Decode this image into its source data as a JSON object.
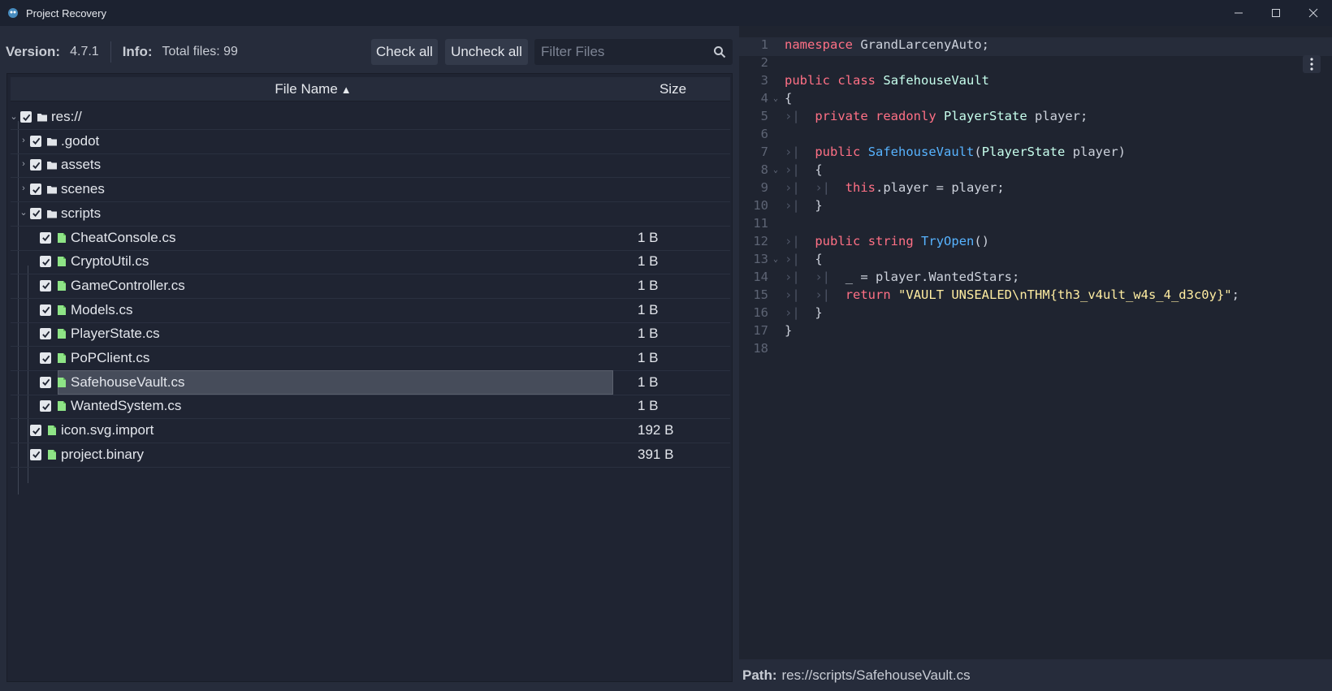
{
  "window": {
    "title": "Project Recovery",
    "controls": [
      "minimize-icon",
      "maximize-icon",
      "close-icon"
    ]
  },
  "toolbar": {
    "version_label": "Version:",
    "version_value": "4.7.1",
    "info_label": "Info:",
    "info_value": "Total files: 99",
    "check_all": "Check all",
    "uncheck_all": "Uncheck all",
    "filter_placeholder": "Filter Files"
  },
  "tree": {
    "columns": {
      "name": "File Name",
      "size": "Size"
    },
    "rows": [
      {
        "name": "res://",
        "size": "",
        "type": "folder",
        "expanded": true
      },
      {
        "name": ".godot",
        "size": "",
        "type": "folder",
        "expanded": false
      },
      {
        "name": "assets",
        "size": "",
        "type": "folder",
        "expanded": false
      },
      {
        "name": "scenes",
        "size": "",
        "type": "folder",
        "expanded": false
      },
      {
        "name": "scripts",
        "size": "",
        "type": "folder",
        "expanded": true
      },
      {
        "name": "CheatConsole.cs",
        "size": "1 B",
        "type": "file"
      },
      {
        "name": "CryptoUtil.cs",
        "size": "1 B",
        "type": "file"
      },
      {
        "name": "GameController.cs",
        "size": "1 B",
        "type": "file"
      },
      {
        "name": "Models.cs",
        "size": "1 B",
        "type": "file"
      },
      {
        "name": "PlayerState.cs",
        "size": "1 B",
        "type": "file"
      },
      {
        "name": "PoPClient.cs",
        "size": "1 B",
        "type": "file"
      },
      {
        "name": "SafehouseVault.cs",
        "size": "1 B",
        "type": "file",
        "selected": true
      },
      {
        "name": "WantedSystem.cs",
        "size": "1 B",
        "type": "file"
      },
      {
        "name": "icon.svg.import",
        "size": "192 B",
        "type": "file"
      },
      {
        "name": "project.binary",
        "size": "391 B",
        "type": "file"
      }
    ]
  },
  "editor": {
    "line_numbers": [
      "1",
      "2",
      "3",
      "4",
      "5",
      "6",
      "7",
      "8",
      "9",
      "10",
      "11",
      "12",
      "13",
      "14",
      "15",
      "16",
      "17",
      "18"
    ],
    "tokens": {
      "namespace": "namespace",
      "ns_name": "GrandLarcenyAuto;",
      "public": "public",
      "class": "class",
      "class_name": "SafehouseVault",
      "open_brace": "{",
      "close_brace": "}",
      "private": "private",
      "readonly": "readonly",
      "player_type": "PlayerState",
      "player_field": "player;",
      "ctor_name": "SafehouseVault",
      "ctor_params_open": "(",
      "ctor_params_close": "player)",
      "this": "this",
      "assign": ".player = player;",
      "string": "string",
      "method": "TryOpen",
      "parens": "()",
      "discard": "_ = player.WantedStars;",
      "return": "return",
      "str_value": "\"VAULT UNSEALED\\nTHM{th3_v4ult_w4s_4_d3c0y}\"",
      "semicolon": ";"
    }
  },
  "pathbar": {
    "label": "Path:",
    "value": "res://scripts/SafehouseVault.cs"
  },
  "colors": {
    "background": "#262c3b",
    "tree_bg": "#1f2432",
    "editor_bg": "#1f2430",
    "checkbox": "#e4e7ec",
    "file_icon": "#8ee486",
    "keyword": "#ff7085",
    "type": "#42ffc2",
    "function": "#57b3ff",
    "string": "#ffeda1"
  }
}
